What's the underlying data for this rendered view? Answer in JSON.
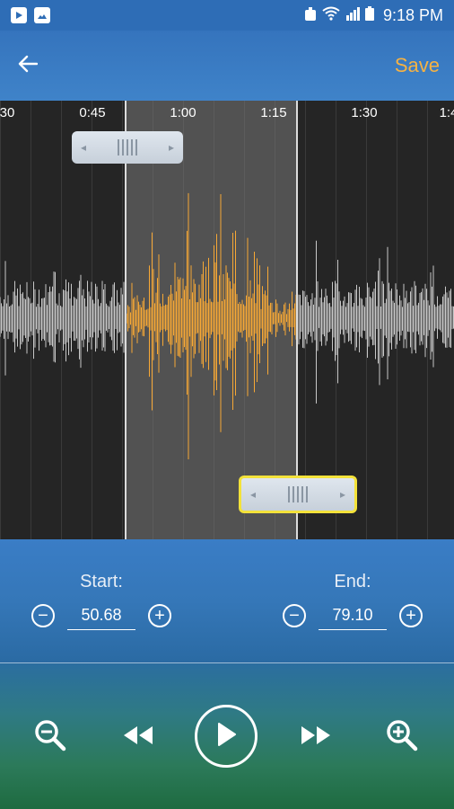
{
  "status_bar": {
    "time": "9:18 PM"
  },
  "toolbar": {
    "save_label": "Save"
  },
  "timeline": {
    "ticks": [
      {
        "label": "30"
      },
      {
        "label": "0:45"
      },
      {
        "label": "1:00"
      },
      {
        "label": "1:15"
      },
      {
        "label": "1:30"
      },
      {
        "label": "1:4"
      }
    ]
  },
  "trim": {
    "start_label": "Start:",
    "start_value": "50.68",
    "end_label": "End:",
    "end_value": "79.10"
  },
  "colors": {
    "accent": "#f6b243",
    "selected_wave": "#f7a835",
    "unselected_wave": "#c8c8c8",
    "active_handle_border": "#f3e23a"
  },
  "icons": {
    "back": "arrow-left-icon",
    "zoom_out": "zoom-out-icon",
    "rewind": "rewind-icon",
    "play": "play-icon",
    "fast_forward": "fast-forward-icon",
    "zoom_in": "zoom-in-icon"
  }
}
